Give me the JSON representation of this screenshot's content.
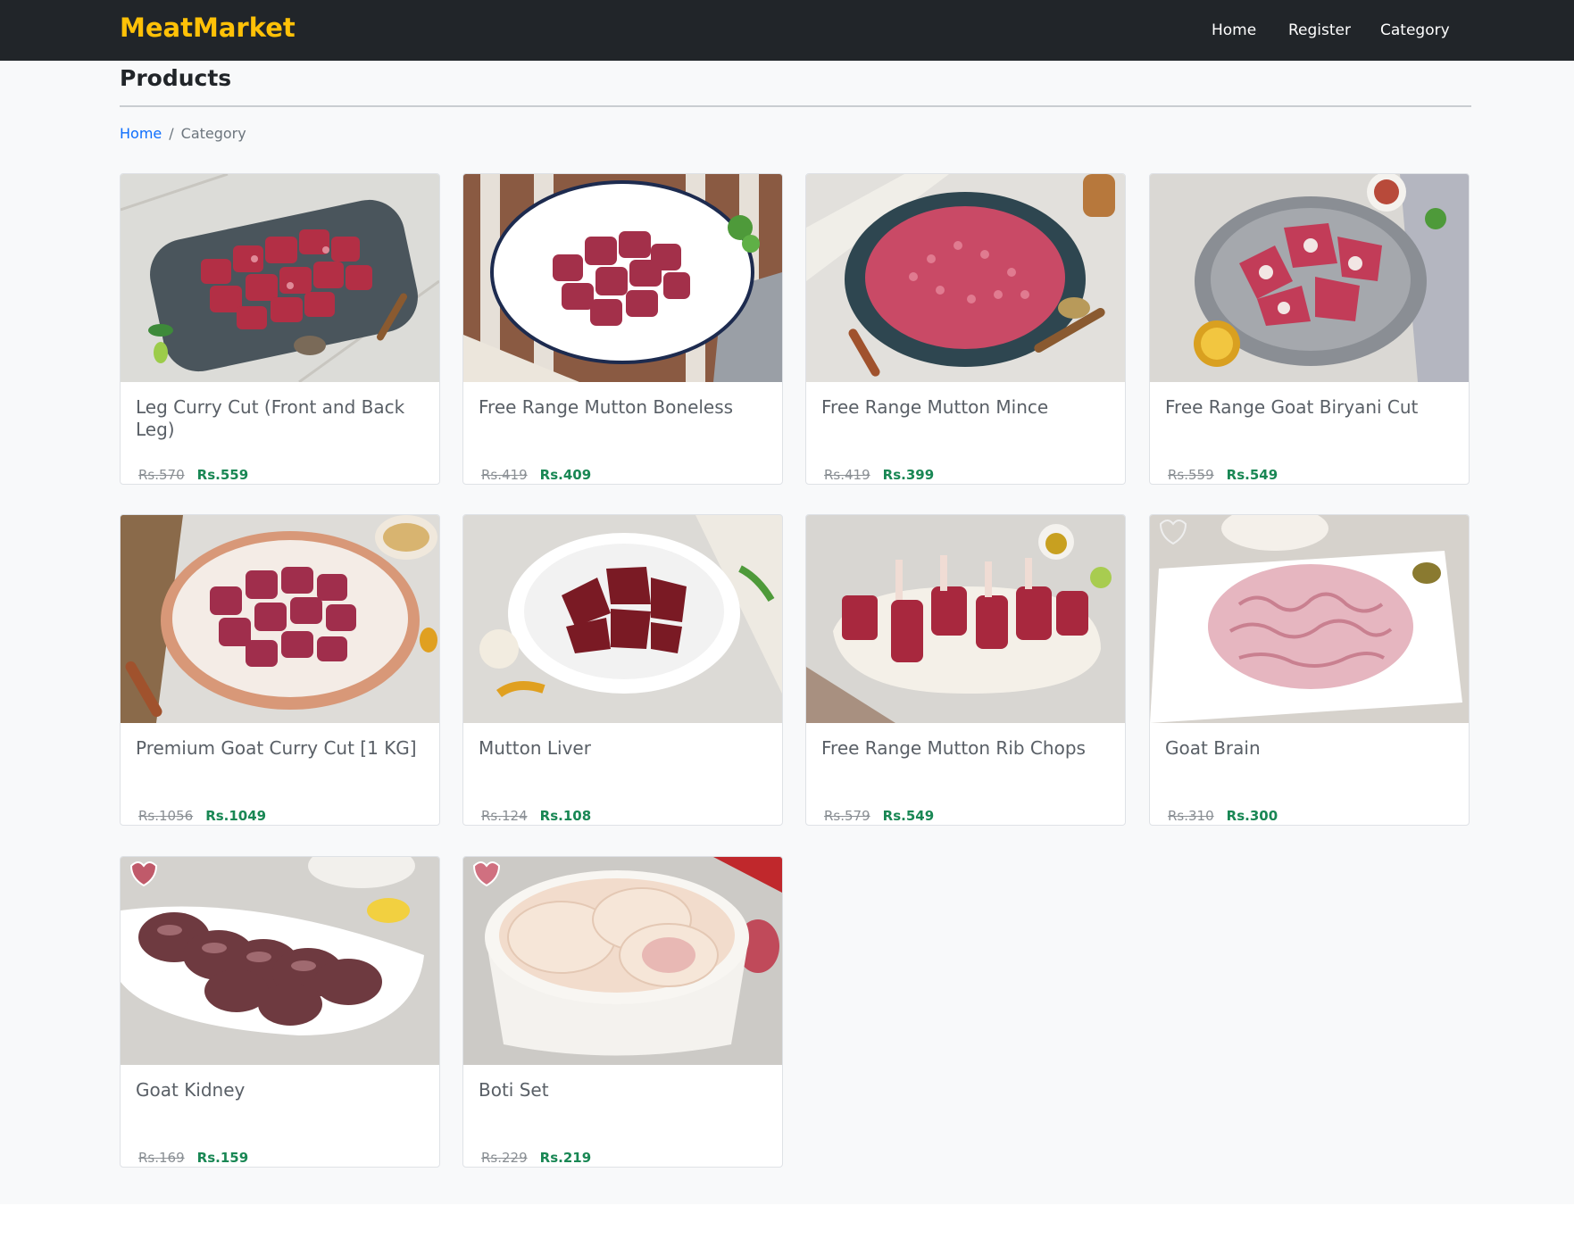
{
  "nav": {
    "brand": "MeatMarket",
    "links": [
      {
        "label": "Home"
      },
      {
        "label": "Register"
      },
      {
        "label": "Category"
      }
    ]
  },
  "page": {
    "title": "Products",
    "breadcrumb": [
      {
        "label": "Home"
      },
      {
        "label": "Category"
      }
    ]
  },
  "products": [
    {
      "name": "Leg Curry Cut (Front and Back Leg)",
      "old_price": "Rs.570",
      "price": "Rs.559"
    },
    {
      "name": "Free Range Mutton Boneless",
      "old_price": "Rs.419",
      "price": "Rs.409"
    },
    {
      "name": "Free Range Mutton Mince",
      "old_price": "Rs.419",
      "price": "Rs.399"
    },
    {
      "name": "Free Range Goat Biryani Cut",
      "old_price": "Rs.559",
      "price": "Rs.549"
    },
    {
      "name": "Premium Goat Curry Cut [1 KG]",
      "old_price": "Rs.1056",
      "price": "Rs.1049"
    },
    {
      "name": "Mutton Liver",
      "old_price": "Rs.124",
      "price": "Rs.108"
    },
    {
      "name": "Free Range Mutton Rib Chops",
      "old_price": "Rs.579",
      "price": "Rs.549"
    },
    {
      "name": "Goat Brain",
      "old_price": "Rs.310",
      "price": "Rs.300"
    },
    {
      "name": "Goat Kidney",
      "old_price": "Rs.169",
      "price": "Rs.159"
    },
    {
      "name": "Boti Set",
      "old_price": "Rs.229",
      "price": "Rs.219"
    }
  ]
}
